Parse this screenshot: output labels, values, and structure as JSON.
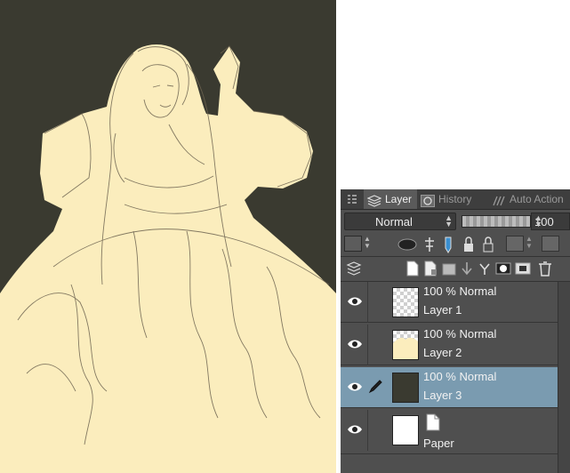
{
  "colors": {
    "canvas_background": "#3a3a30",
    "fill_cream": "#fbedbd",
    "panel_bg": "#4f4f4f",
    "selected_layer": "#7a9bb0",
    "layer3_thumb": "#3a3a30"
  },
  "tabs": [
    {
      "label": "Layer",
      "icon": "layer-stack-icon"
    },
    {
      "label": "History",
      "icon": "history-icon"
    },
    {
      "label": "Auto Action",
      "icon": "auto-action-icon"
    }
  ],
  "blend_mode": {
    "selected": "Normal"
  },
  "opacity": {
    "value": "100"
  },
  "layers": [
    {
      "opacity_mode": "100 % Normal",
      "name": "Layer 1",
      "thumb": "transparent",
      "selected": false
    },
    {
      "opacity_mode": "100 % Normal",
      "name": "Layer 2",
      "thumb": "cream",
      "selected": false
    },
    {
      "opacity_mode": "100 % Normal",
      "name": "Layer 3",
      "thumb": "dark",
      "selected": true
    },
    {
      "opacity_mode": "",
      "name": "Paper",
      "thumb": "white",
      "selected": false
    }
  ]
}
